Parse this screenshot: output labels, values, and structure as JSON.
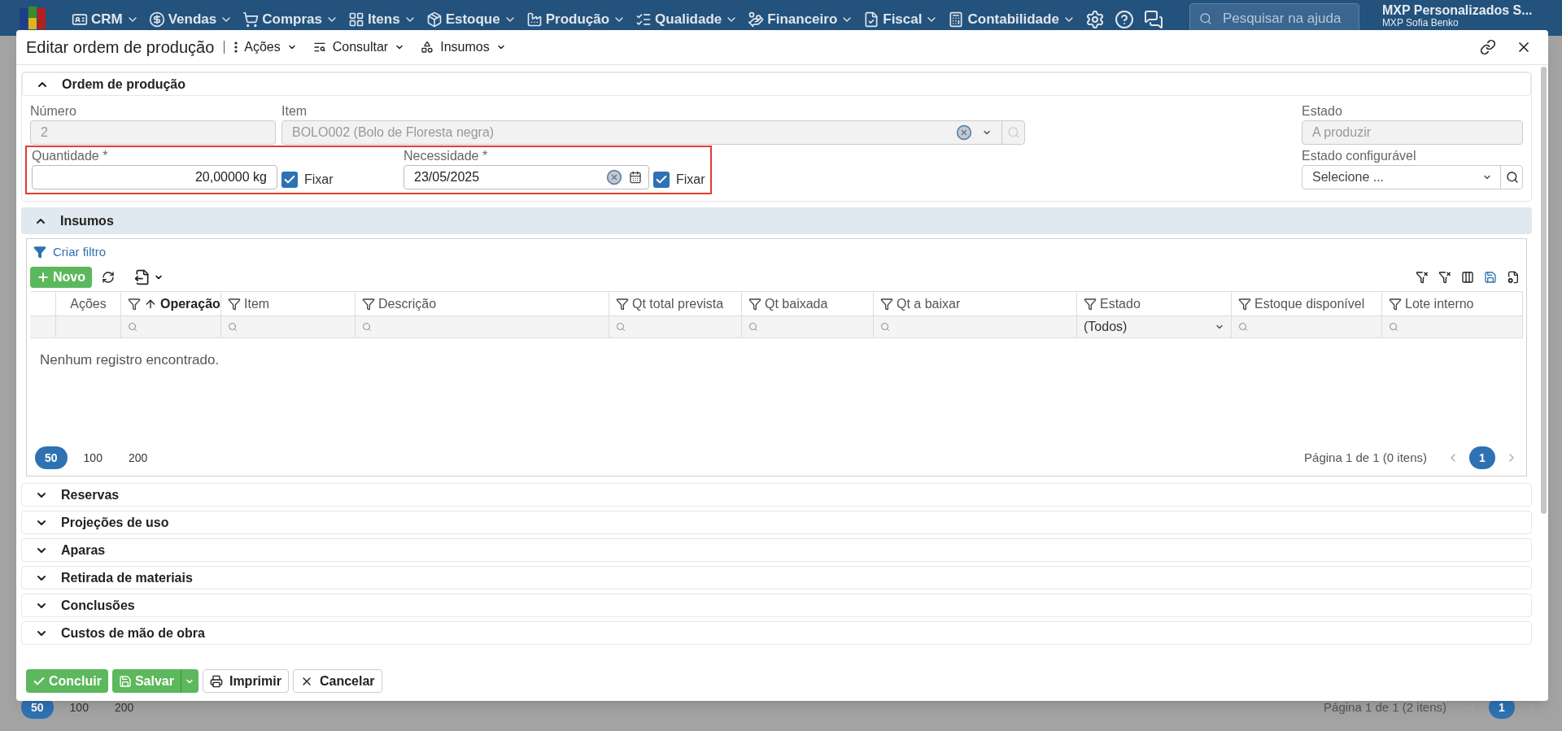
{
  "nav": {
    "items": [
      {
        "label": "CRM"
      },
      {
        "label": "Vendas"
      },
      {
        "label": "Compras"
      },
      {
        "label": "Itens"
      },
      {
        "label": "Estoque"
      },
      {
        "label": "Produção"
      },
      {
        "label": "Qualidade"
      },
      {
        "label": "Financeiro"
      },
      {
        "label": "Fiscal"
      },
      {
        "label": "Contabilidade"
      }
    ],
    "search": {
      "placeholder": "Pesquisar na ajuda"
    },
    "user": {
      "company": "MXP Personalizados S...",
      "name": "MXP Sofia Benko"
    }
  },
  "modal": {
    "title": "Editar ordem de produção",
    "menus": [
      "Ações",
      "Consultar",
      "Insumos"
    ]
  },
  "order_section": {
    "title": "Ordem de produção",
    "expanded": true,
    "highlight": true,
    "numero": {
      "label": "Número",
      "value": "2",
      "disabled": true
    },
    "item": {
      "label": "Item",
      "value": "BOLO002 (Bolo de Floresta negra)",
      "disabled": true
    },
    "estado": {
      "label": "Estado",
      "value": "A produzir",
      "disabled": true
    },
    "quantidade": {
      "label": "Quantidade *",
      "value": "20,00000 kg",
      "fix": {
        "label": "Fixar",
        "checked": true
      }
    },
    "necessidade": {
      "label": "Necessidade *",
      "value": "23/05/2025",
      "fix": {
        "label": "Fixar",
        "checked": true
      }
    },
    "estado_configuravel": {
      "label": "Estado configurável",
      "placeholder": "Selecione ..."
    }
  },
  "insumos": {
    "title": "Insumos",
    "expanded": true,
    "filter_link": "Criar filtro",
    "new_button": "Novo",
    "columns": [
      {
        "label": "Ações",
        "filterable": false,
        "sorted": false,
        "filter": {
          "kind": "none"
        }
      },
      {
        "label": "Operação",
        "filterable": true,
        "sorted": true,
        "filter": {
          "kind": "search"
        }
      },
      {
        "label": "Item",
        "filterable": true,
        "sorted": false,
        "filter": {
          "kind": "search"
        }
      },
      {
        "label": "Descrição",
        "filterable": true,
        "sorted": false,
        "filter": {
          "kind": "search"
        }
      },
      {
        "label": "Qt total prevista",
        "filterable": true,
        "sorted": false,
        "filter": {
          "kind": "search"
        }
      },
      {
        "label": "Qt baixada",
        "filterable": true,
        "sorted": false,
        "filter": {
          "kind": "search"
        }
      },
      {
        "label": "Qt a baixar",
        "filterable": true,
        "sorted": false,
        "filter": {
          "kind": "search"
        }
      },
      {
        "label": "Estado",
        "filterable": true,
        "sorted": false,
        "filter": {
          "kind": "select",
          "value": "(Todos)"
        }
      },
      {
        "label": "Estoque disponível",
        "filterable": true,
        "sorted": false,
        "filter": {
          "kind": "search"
        }
      },
      {
        "label": "Lote interno",
        "filterable": true,
        "sorted": false,
        "filter": {
          "kind": "search"
        }
      }
    ],
    "empty_message": "Nenhum registro encontrado.",
    "page_sizes": [
      {
        "label": "50",
        "selected": true
      },
      {
        "label": "100",
        "selected": false
      },
      {
        "label": "200",
        "selected": false
      }
    ],
    "page_info": "Página 1 de 1 (0 itens)",
    "pages": [
      {
        "label": "1",
        "selected": true
      }
    ]
  },
  "sections": [
    {
      "title": "Reservas",
      "expanded": false
    },
    {
      "title": "Projeções de uso",
      "expanded": false
    },
    {
      "title": "Aparas",
      "expanded": false
    },
    {
      "title": "Retirada de materiais",
      "expanded": false
    },
    {
      "title": "Conclusões",
      "expanded": false
    },
    {
      "title": "Custos de mão de obra",
      "expanded": false
    }
  ],
  "footer_buttons": [
    {
      "label": "Concluir",
      "kind": "conclude"
    },
    {
      "label": "Salvar",
      "kind": "save"
    },
    {
      "label": "Imprimir",
      "kind": "print"
    },
    {
      "label": "Cancelar",
      "kind": "cancel"
    }
  ],
  "background_pager": {
    "page_sizes": [
      {
        "label": "50",
        "selected": true
      },
      {
        "label": "100",
        "selected": false
      },
      {
        "label": "200",
        "selected": false
      }
    ],
    "page_info": "Página 1 de 1 (2 itens)",
    "pages": [
      {
        "label": "1",
        "selected": true
      }
    ]
  }
}
